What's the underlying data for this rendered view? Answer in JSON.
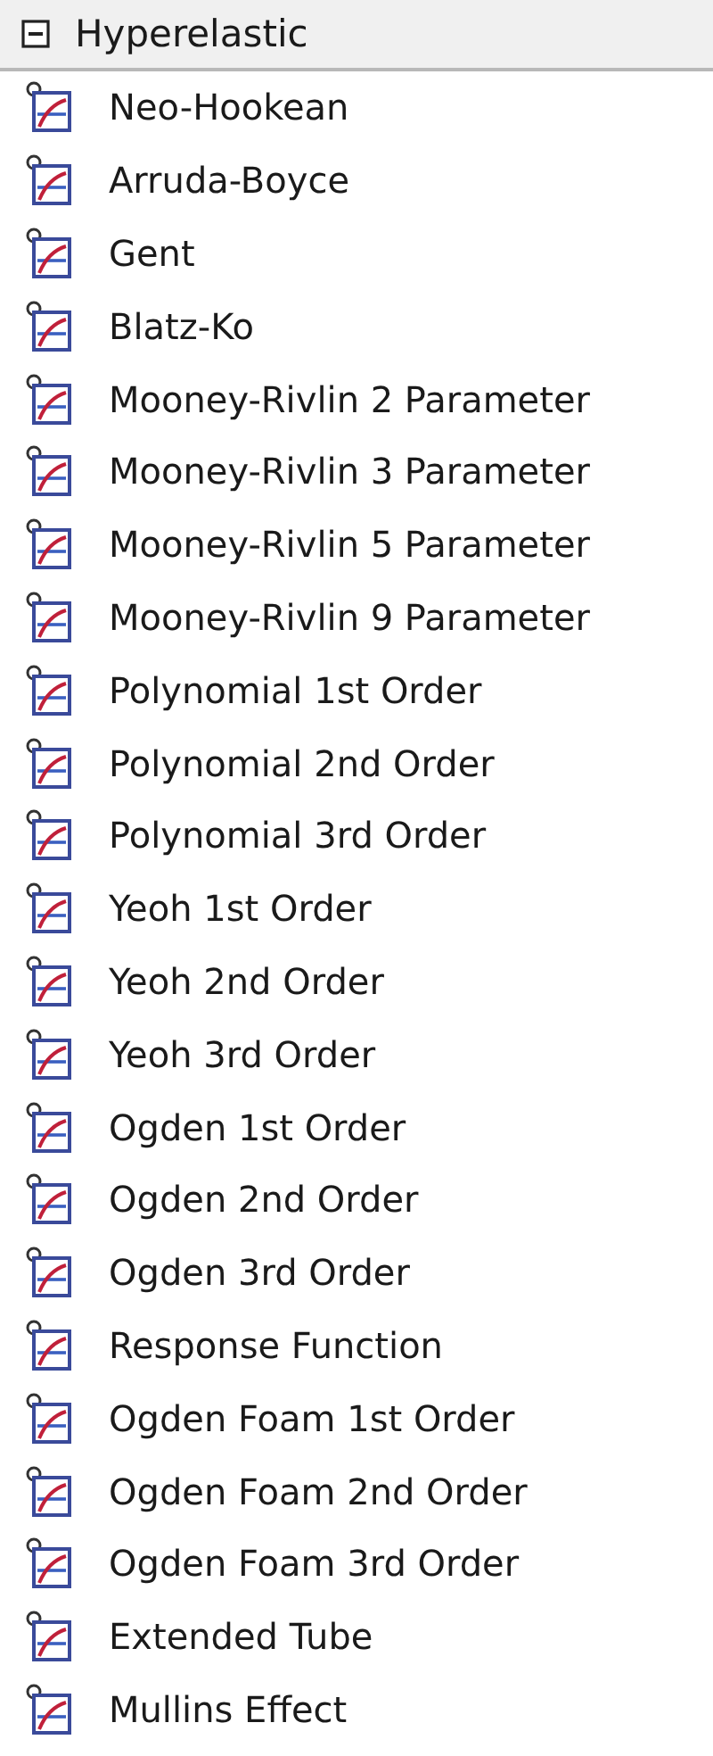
{
  "group": {
    "label": "Hyperelastic",
    "expanded": true,
    "children": [
      {
        "label": "Neo-Hookean"
      },
      {
        "label": "Arruda-Boyce"
      },
      {
        "label": "Gent"
      },
      {
        "label": "Blatz-Ko"
      },
      {
        "label": "Mooney-Rivlin 2 Parameter"
      },
      {
        "label": "Mooney-Rivlin 3 Parameter"
      },
      {
        "label": "Mooney-Rivlin 5 Parameter"
      },
      {
        "label": "Mooney-Rivlin 9 Parameter"
      },
      {
        "label": "Polynomial 1st Order"
      },
      {
        "label": "Polynomial 2nd Order"
      },
      {
        "label": "Polynomial 3rd Order"
      },
      {
        "label": "Yeoh 1st Order"
      },
      {
        "label": "Yeoh 2nd Order"
      },
      {
        "label": "Yeoh 3rd Order"
      },
      {
        "label": "Ogden 1st Order"
      },
      {
        "label": "Ogden 2nd Order"
      },
      {
        "label": "Ogden 3rd Order"
      },
      {
        "label": "Response Function"
      },
      {
        "label": "Ogden Foam 1st Order"
      },
      {
        "label": "Ogden Foam 2nd Order"
      },
      {
        "label": "Ogden Foam 3rd Order"
      },
      {
        "label": "Extended Tube"
      },
      {
        "label": "Mullins Effect"
      }
    ]
  }
}
